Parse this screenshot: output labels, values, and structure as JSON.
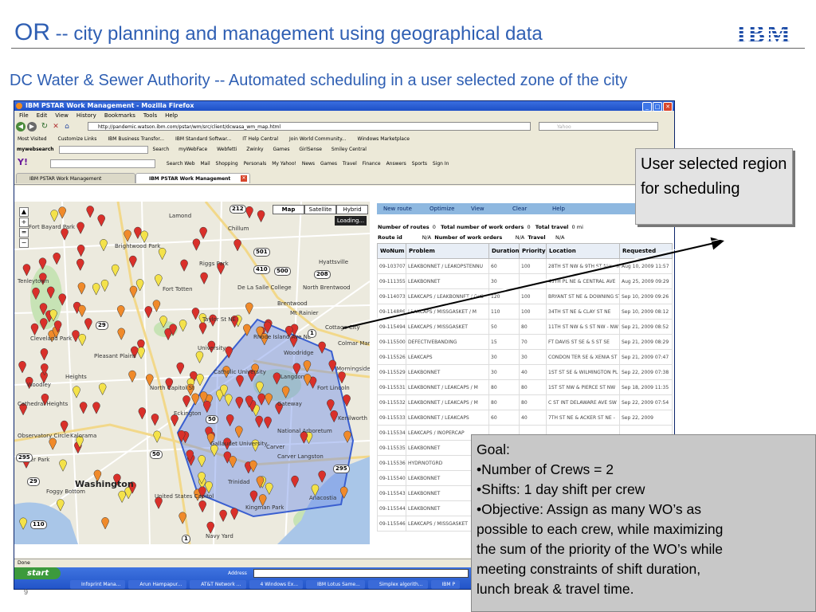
{
  "slide": {
    "title_prefix": "OR",
    "title_rest": " -- city planning and management using geographical data",
    "logo": "IBM",
    "subtitle": "DC Water & Sewer Authority -- Automated scheduling in a user selected zone of the city",
    "page_number": "9"
  },
  "browser": {
    "window_title": "IBM PSTAR Work Management - Mozilla Firefox",
    "menu": [
      "File",
      "Edit",
      "View",
      "History",
      "Bookmarks",
      "Tools",
      "Help"
    ],
    "url": "http://pandemic.watson.ibm.com/pstar/wm/src/client/dcwasa_wm_map.html",
    "search_placeholder": "Yahoo",
    "bookmarks": [
      "Most Visited",
      "Customize Links",
      "IBM Business Transfor...",
      "IBM Standard Softwar...",
      "IT Help Central",
      "Join World Community...",
      "Windows Marketplace"
    ],
    "toolbar2": {
      "brand": "mywebsearch",
      "search_btn": "Search",
      "items": [
        "myWebFace",
        "Webfetti",
        "Zwinky",
        "Games",
        "GirlSense",
        "Smiley Central"
      ]
    },
    "toolbar3": {
      "logo": "Y!",
      "items": [
        "Search Web",
        "Mail",
        "Shopping",
        "Personals",
        "My Yahoo!",
        "News",
        "Games",
        "Travel",
        "Finance",
        "Answers",
        "Sports",
        "Sign In"
      ]
    },
    "tabs": [
      "IBM PSTAR Work Management",
      "IBM PSTAR Work Management"
    ],
    "status": "Done"
  },
  "map": {
    "types": [
      "Map",
      "Satellite",
      "Hybrid"
    ],
    "loading": "Loading...",
    "labels": {
      "chillum": "Chillum",
      "hyattsville": "Hyattsville",
      "north_brentwood": "North Brentwood",
      "brentwood": "Brentwood",
      "mt_rainier": "Mt Rainier",
      "cottage_city": "Cottage City",
      "colmar_manor": "Colmar Manor",
      "woodridge": "Woodridge",
      "langdon": "Langdon",
      "washington": "Washington",
      "fort_totten": "Fort Totten",
      "gallaudet": "Gallaudet University",
      "national_arboretum": "National Arboretum",
      "kenilworth": "Kenilworth",
      "carver_langston": "Carver Langston",
      "fort_bayard": "Fort Bayard Park",
      "brightwood": "Brightwood Park",
      "cleveland_park": "Cleveland Park",
      "woodley": "Woodley",
      "heights": "Heights",
      "anacostia": "Anacostia",
      "us_capitol": "United States Capitol",
      "navy_yard": "Navy Yard",
      "lamond": "Lamond",
      "riggs_park": "Riggs Park",
      "taylor_st": "Taylor St NE",
      "north_capitol": "North Capitol St",
      "de_la_salle": "De La Salle College",
      "pleasant": "Pleasant Plains",
      "eckington": "Eckington",
      "kingman_park": "Kingman Park",
      "gateway": "Gateway",
      "carver": "Carver",
      "morningside": "Morningside",
      "trinidad": "Trinidad",
      "university": "University",
      "fort_lincoln": "Fort Lincoln",
      "cathedral": "Cathedral Heights",
      "kalorama": "Kalorama",
      "foggy": "Foggy Bottom",
      "observatory": "Observatory Circle",
      "glover": "Glover Park",
      "tenleytown": "Tenleytown",
      "catholic": "Catholic University",
      "rhode_island": "Rhode Island Ave NE"
    },
    "highways": [
      "212",
      "501",
      "410",
      "500",
      "208",
      "1",
      "50",
      "50",
      "295",
      "110",
      "29",
      "1",
      "29",
      "295"
    ]
  },
  "pane": {
    "buttons": [
      "New route",
      "Optimize",
      "View",
      "Clear",
      "Help"
    ],
    "summary": {
      "num_routes_label": "Number of routes",
      "num_routes": "0",
      "total_wo_label": "Total number of work orders",
      "total_wo": "0",
      "total_travel_label": "Total travel",
      "total_travel": "0 mi",
      "route_id_label": "Route id",
      "route_id": "N/A",
      "num_wo_label": "Number of work orders",
      "num_wo": "N/A",
      "travel_label": "Travel",
      "travel": "N/A"
    },
    "columns": [
      "WoNum",
      "Problem",
      "Duration",
      "Priority",
      "Location",
      "Requested"
    ],
    "rows": [
      [
        "09-103707",
        "LEAKBONNET / LEAKOPSTENNU",
        "60",
        "100",
        "28TH ST NW & 9TH ST NW - NW",
        "Aug 10, 2009 11:57"
      ],
      [
        "09-111355",
        "LEAKBONNET",
        "30",
        "",
        "45TH PL NE & CENTRAL AVE",
        "Aug 25, 2009 09:29"
      ],
      [
        "09-114073",
        "LEAKCAPS / LEAKBONNET / OPS",
        "120",
        "100",
        "BRYANT ST NE & DOWNING ST",
        "Sep 10, 2009 09:26"
      ],
      [
        "09-114886",
        "LEAKCAPS / MISSGASKET / M",
        "110",
        "100",
        "34TH ST NE & CLAY ST NE",
        "Sep 10, 2009 08:12"
      ],
      [
        "09-115494",
        "LEAKCAPS / MISSGASKET",
        "50",
        "80",
        "11TH ST NW & S ST NW - NW",
        "Sep 21, 2009 08:52"
      ],
      [
        "09-115500",
        "DEFECTIVEBANDING",
        "15",
        "70",
        "FT DAVIS ST SE & S ST SE",
        "Sep 21, 2009 08:29"
      ],
      [
        "09-115526",
        "LEAKCAPS",
        "30",
        "30",
        "CONDON TER SE & XENIA ST",
        "Sep 21, 2009 07:47"
      ],
      [
        "09-115529",
        "LEAKBONNET",
        "30",
        "40",
        "1ST ST SE & WILMINGTON PL",
        "Sep 22, 2009 07:38"
      ],
      [
        "09-115531",
        "LEAKBONNET / LEAKCAPS / M",
        "80",
        "80",
        "1ST ST NW & PIERCE ST NW",
        "Sep 18, 2009 11:35"
      ],
      [
        "09-115532",
        "LEAKBONNET / LEAKCAPS / M",
        "80",
        "80",
        "C ST INT DELAWARE AVE SW",
        "Sep 22, 2009 07:54"
      ],
      [
        "09-115533",
        "LEAKBONNET / LEAKCAPS",
        "60",
        "40",
        "7TH ST NE & ACKER ST NE -",
        "Sep 22, 2009"
      ],
      [
        "09-115534",
        "LEAKCAPS / INOPERCAP",
        "",
        "",
        "",
        ""
      ],
      [
        "09-115535",
        "LEAKBONNET",
        "",
        "",
        "",
        ""
      ],
      [
        "09-115536",
        "HYDRNOTGRD",
        "",
        "",
        "",
        ""
      ],
      [
        "09-115540",
        "LEAKBONNET",
        "",
        "",
        "",
        ""
      ],
      [
        "09-115543",
        "LEAKBONNET",
        "",
        "",
        "",
        ""
      ],
      [
        "09-115544",
        "LEAKBONNET",
        "",
        "",
        "",
        ""
      ],
      [
        "09-115546",
        "LEAKCAPS / MISSGASKET",
        "",
        "",
        "",
        ""
      ]
    ]
  },
  "taskbar": {
    "start": "start",
    "address_label": "Address",
    "tasks": [
      "Infoprint Mana...",
      "Arun Hampapur...",
      "AT&T Network ...",
      "4 Windows Ex...",
      "IBM Lotus Same...",
      "Simplex algorith...",
      "IBM P"
    ]
  },
  "callouts": {
    "region": "User selected region for scheduling",
    "goal_lines": [
      "Goal:",
      "•Number of Crews = 2",
      "•Shifts: 1 day shift per crew",
      "•Objective: Assign as many WO’s as",
      "possible to each crew, while maximizing",
      "the sum of the priority of the WO’s while",
      "meeting constraints of shift duration,",
      "lunch break & travel time."
    ]
  },
  "colors": {
    "accent": "#2f5fb3",
    "selection": "#6f8fe8",
    "pin_red": "#d9302a",
    "pin_yellow": "#f4e24a",
    "pin_orange": "#f08a2a"
  }
}
